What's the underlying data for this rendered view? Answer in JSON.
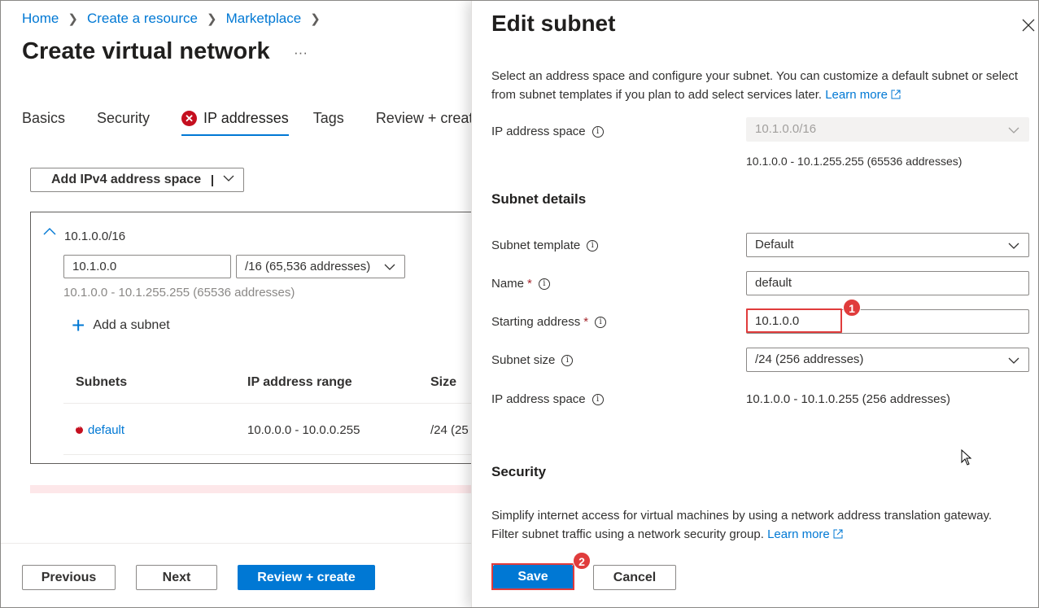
{
  "breadcrumb": [
    {
      "label": "Home"
    },
    {
      "label": "Create a resource"
    },
    {
      "label": "Marketplace"
    }
  ],
  "page": {
    "title": "Create virtual network",
    "more": "···"
  },
  "tabs": [
    {
      "label": "Basics"
    },
    {
      "label": "Security"
    },
    {
      "label": "IP addresses",
      "error": true,
      "error_icon": "error-circle-icon",
      "active": true
    },
    {
      "label": "Tags"
    },
    {
      "label": "Review + create"
    }
  ],
  "address_space_menu": {
    "label": "Add IPv4 address space"
  },
  "address_space": {
    "title": "10.1.0.0/16",
    "start_value": "10.1.0.0",
    "size_value": "/16 (65,536 addresses)",
    "range_hint": "10.1.0.0 - 10.1.255.255 (65536 addresses)",
    "add_subnet": "Add a subnet",
    "table": {
      "headers": [
        "Subnets",
        "IP address range",
        "Size"
      ],
      "rows": [
        {
          "name": "default",
          "range": "10.0.0.0 - 10.0.0.255",
          "size": "/24 (25"
        }
      ]
    }
  },
  "footer": {
    "previous": "Previous",
    "next": "Next",
    "review": "Review + create"
  },
  "panel": {
    "title": "Edit subnet",
    "description": "Select an address space and configure your subnet. You can customize a default subnet or select from subnet templates if you plan to add select services later.",
    "learn_more": "Learn more",
    "ip_space_label": "IP address space",
    "ip_space_value": "10.1.0.0/16",
    "ip_space_range": "10.1.0.0 - 10.1.255.255 (65536 addresses)",
    "subnet_details_heading": "Subnet details",
    "template_label": "Subnet template",
    "template_value": "Default",
    "name_label": "Name",
    "name_value": "default",
    "start_label": "Starting address",
    "start_value": "10.1.0.0",
    "size_label": "Subnet size",
    "size_value": "/24 (256 addresses)",
    "subnet_space_label": "IP address space",
    "subnet_space_value": "10.1.0.0 - 10.1.0.255 (256 addresses)",
    "security_heading": "Security",
    "security_desc": "Simplify internet access for virtual machines by using a network address translation gateway. Filter subnet traffic using a network security group.",
    "security_learn_more": "Learn more",
    "save": "Save",
    "cancel": "Cancel",
    "required_mark": "*"
  },
  "annotations": {
    "badge1": "1",
    "badge2": "2",
    "highlight_color": "#e03c3c"
  },
  "colors": {
    "accent": "#0078d4",
    "error": "#c50f1f"
  }
}
